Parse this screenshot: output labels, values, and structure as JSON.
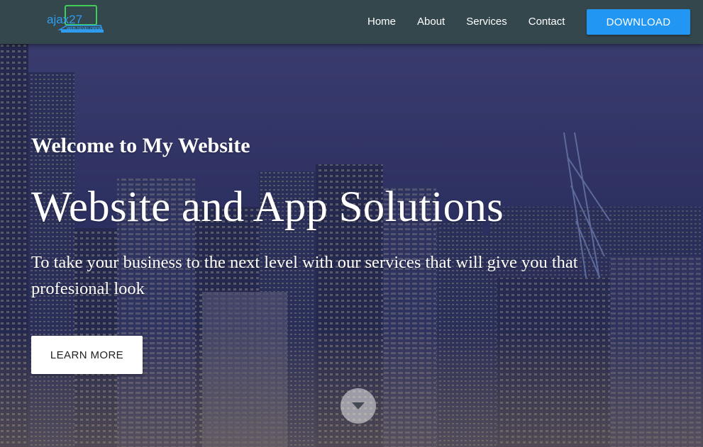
{
  "nav": {
    "logo": {
      "main_text": "ajax27",
      "sub_text": "WEB DEVELOPER",
      "colors": [
        "#2f9cf0",
        "#3ecf5a"
      ]
    },
    "links": [
      {
        "label": "Home"
      },
      {
        "label": "About"
      },
      {
        "label": "Services"
      },
      {
        "label": "Contact"
      }
    ],
    "download_label": "DOWNLOAD",
    "background_color": "#34474d",
    "accent_color": "#2196f3"
  },
  "hero": {
    "welcome": "Welcome to My Website",
    "title": "Website and App Solutions",
    "subtitle": "To take your business to the next level with our services that will give you that profesional look",
    "learn_more_label": "LEARN MORE",
    "scroll_icon": "chevron-down-icon"
  }
}
